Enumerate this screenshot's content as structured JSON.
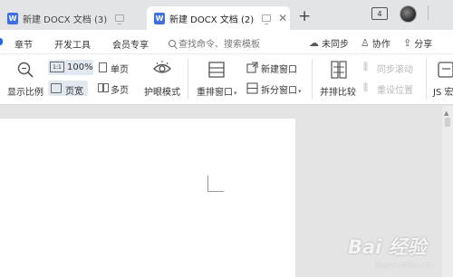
{
  "tabs": [
    {
      "title": "新建 DOCX 文档 (3)",
      "icon": "W"
    },
    {
      "title": "新建 DOCX 文档 (2)",
      "icon": "W"
    }
  ],
  "tabbar": {
    "new_tab": "+",
    "window_count": "4"
  },
  "menu": {
    "items": [
      "章节",
      "开发工具",
      "会员专享"
    ],
    "search_placeholder": "查找命令、搜索模板",
    "unsynced": "未同步",
    "collaborate": "协作",
    "share": "分享"
  },
  "ribbon": {
    "show_scale": "显示比例",
    "zoom_100": "100%",
    "page_width": "页宽",
    "single_page": "单页",
    "multi_page": "多页",
    "eye_mode": "护眼模式",
    "rearrange_window": "重排窗口",
    "new_window": "新建窗口",
    "split_window": "拆分窗口",
    "side_by_side": "并排比较",
    "sync_scroll": "同步滚动",
    "reset_position": "重设位置",
    "js_macro": "JS 宏"
  },
  "watermark": {
    "text": "Bai 经验",
    "sub": "jingyan.baidu.com"
  },
  "colors": {
    "accent": "#2b65d9",
    "doc_icon": "#3d6fe0",
    "tab_bg": "#e3e4e6",
    "canvas_bg": "#e4e4e4"
  }
}
